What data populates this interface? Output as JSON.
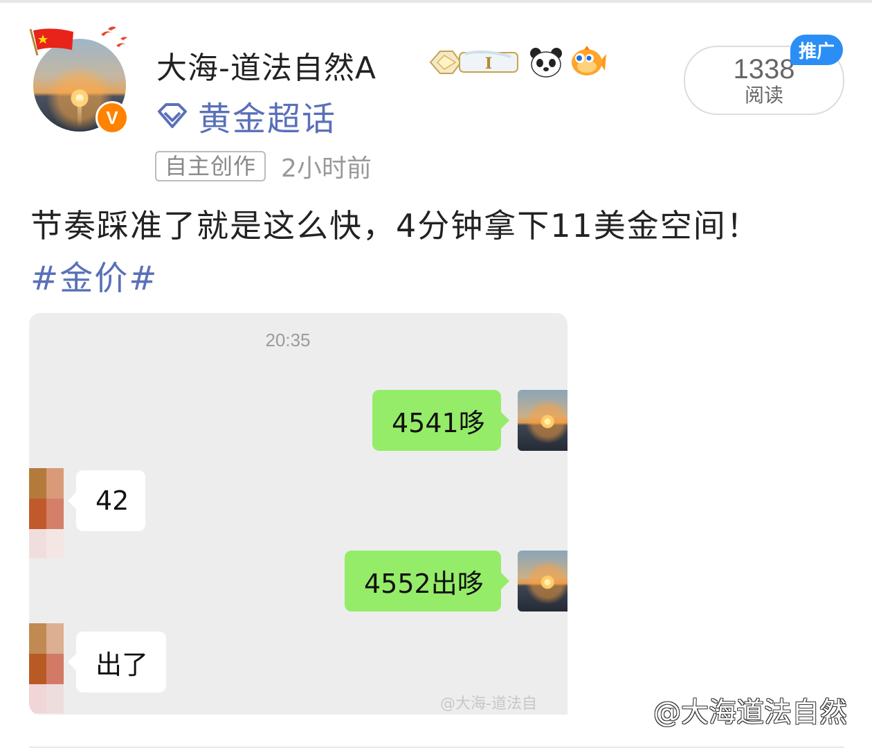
{
  "post": {
    "author": {
      "name": "大海-道法自然A",
      "verified_badge": "V",
      "avatar_icon": "sunset-avatar",
      "badge_icons": [
        "flag-icon",
        "level-badge-icon",
        "panda-icon",
        "fish-icon"
      ]
    },
    "topic_label": "黄金超话",
    "tag_label": "自主创作",
    "time_label": "2小时前",
    "read_count": "1338",
    "read_label": "阅读",
    "promo_label": "推广",
    "text": "节奏踩准了就是这么快，4分钟拿下11美金空间！",
    "hashtag": "#金价#"
  },
  "chat": {
    "time": "20:35",
    "messages": [
      {
        "side": "right",
        "text": "4541哆"
      },
      {
        "side": "left",
        "text": "42"
      },
      {
        "side": "right",
        "text": "4552出哆"
      },
      {
        "side": "left",
        "text": "出了"
      }
    ],
    "watermark": "@大海-道法自"
  },
  "page_watermark": "@大海道法自然",
  "colors": {
    "link_blue": "#5a70b8",
    "promo_blue": "#2b8ef5",
    "verified_orange": "#ff8200",
    "wechat_green": "#95ec69",
    "chat_bg": "#ededed"
  }
}
